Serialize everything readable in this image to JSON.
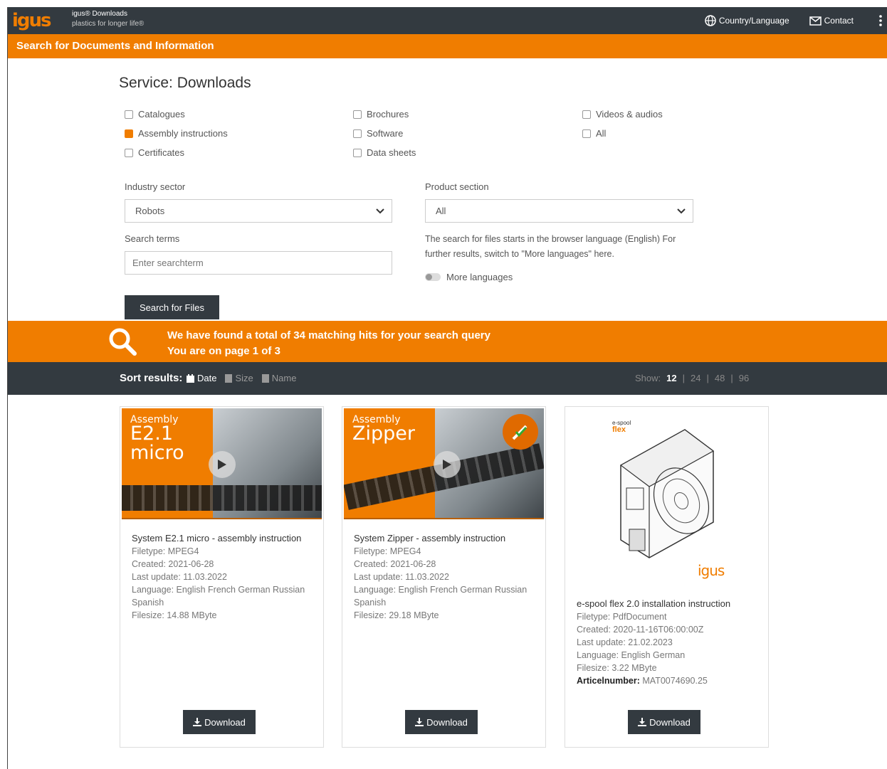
{
  "header": {
    "logo": "igus",
    "brand_line1": "igus® Downloads",
    "brand_line2": "plastics for longer life®",
    "country_language": "Country/Language",
    "contact": "Contact"
  },
  "subbar_title": "Search for Documents and Information",
  "page_title": "Service: Downloads",
  "filters": [
    {
      "label": "Catalogues",
      "checked": false
    },
    {
      "label": "Assembly instructions",
      "checked": true
    },
    {
      "label": "Certificates",
      "checked": false
    },
    {
      "label": "Brochures",
      "checked": false
    },
    {
      "label": "Software",
      "checked": false
    },
    {
      "label": "Data sheets",
      "checked": false
    },
    {
      "label": "Videos & audios",
      "checked": false
    },
    {
      "label": "All",
      "checked": false
    }
  ],
  "industry": {
    "label": "Industry sector",
    "value": "Robots"
  },
  "product": {
    "label": "Product section",
    "value": "All"
  },
  "search": {
    "label": "Search terms",
    "placeholder": "Enter searchterm",
    "button": "Search for Files"
  },
  "lang_hint": "The search for files starts in the browser language (English) For further results, switch to \"More languages\" here.",
  "more_languages": "More languages",
  "results": {
    "line1": "We have found a total of 34 matching hits for your search query",
    "line2": "You are on page 1 of 3"
  },
  "sort": {
    "label": "Sort results:",
    "options": [
      "Date",
      "Size",
      "Name"
    ],
    "show_label": "Show:",
    "show_counts": [
      "12",
      "24",
      "48",
      "96"
    ]
  },
  "cards": [
    {
      "thumb_small": "Assembly",
      "thumb_big1": "E2.1",
      "thumb_big2": "micro",
      "name": "System E2.1 micro - assembly instruction",
      "filetype": "Filetype: MPEG4",
      "created": "Created: 2021-06-28",
      "updated": "Last update: 11.03.2022",
      "language": "Language: English French German Russian Spanish",
      "filesize": "Filesize: 14.88 MByte",
      "download": "Download"
    },
    {
      "thumb_small": "Assembly",
      "thumb_big1": "Zipper",
      "name": "System Zipper - assembly instruction",
      "filetype": "Filetype: MPEG4",
      "created": "Created: 2021-06-28",
      "updated": "Last update: 11.03.2022",
      "language": "Language: English French German Russian Spanish",
      "filesize": "Filesize: 29.18 MByte",
      "download": "Download"
    },
    {
      "doc_title": "e-spool",
      "doc_brand": "flex",
      "doc_logo": "igus",
      "name": "e-spool flex 2.0 installation instruction",
      "filetype": "Filetype: PdfDocument",
      "created": "Created: 2020-11-16T06:00:00Z",
      "updated": "Last update: 21.02.2023",
      "language": "Language: English German",
      "filesize": "Filesize: 3.22 MByte",
      "article_label": "Articelnumber:",
      "article_value": "MAT0074690.25",
      "download": "Download"
    }
  ],
  "colors": {
    "accent": "#f07d00",
    "dark": "#333a40"
  }
}
